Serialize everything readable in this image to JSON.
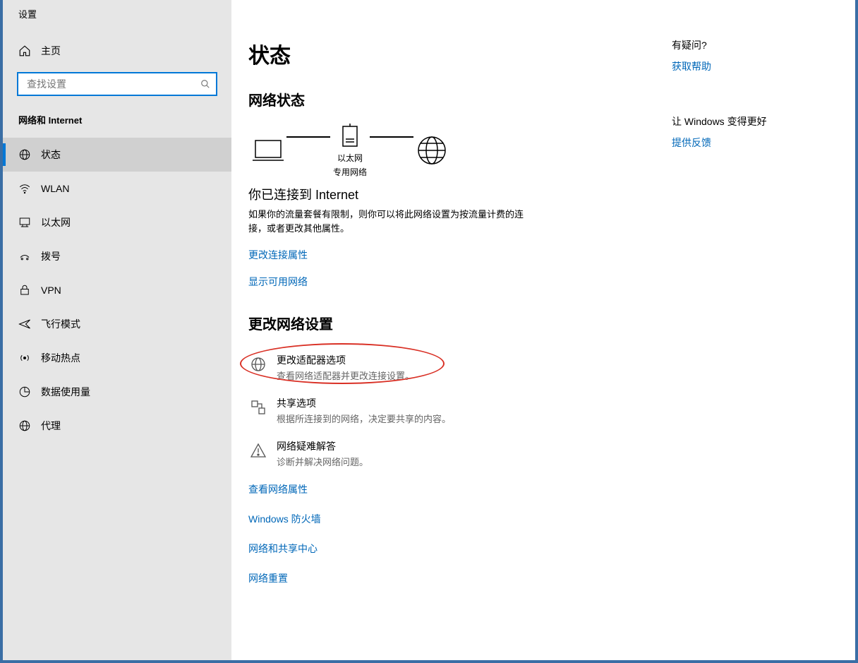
{
  "window": {
    "title": "设置"
  },
  "sidebar": {
    "home": "主页",
    "search_placeholder": "查找设置",
    "section": "网络和 Internet",
    "items": [
      {
        "label": "状态"
      },
      {
        "label": "WLAN"
      },
      {
        "label": "以太网"
      },
      {
        "label": "拨号"
      },
      {
        "label": "VPN"
      },
      {
        "label": "飞行模式"
      },
      {
        "label": "移动热点"
      },
      {
        "label": "数据使用量"
      },
      {
        "label": "代理"
      }
    ]
  },
  "main": {
    "title": "状态",
    "network_status_heading": "网络状态",
    "diagram": {
      "mid_top": "以太网",
      "mid_bottom": "专用网络"
    },
    "connected_heading": "你已连接到 Internet",
    "connected_desc": "如果你的流量套餐有限制，则你可以将此网络设置为按流量计费的连接，或者更改其他属性。",
    "link_change_props": "更改连接属性",
    "link_show_networks": "显示可用网络",
    "change_settings_heading": "更改网络设置",
    "options": [
      {
        "title": "更改适配器选项",
        "sub": "查看网络适配器并更改连接设置。"
      },
      {
        "title": "共享选项",
        "sub": "根据所连接到的网络，决定要共享的内容。"
      },
      {
        "title": "网络疑难解答",
        "sub": "诊断并解决网络问题。"
      }
    ],
    "bottom_links": [
      "查看网络属性",
      "Windows 防火墙",
      "网络和共享中心",
      "网络重置"
    ]
  },
  "right": {
    "question": "有疑问?",
    "help": "获取帮助",
    "better": "让 Windows 变得更好",
    "feedback": "提供反馈"
  }
}
